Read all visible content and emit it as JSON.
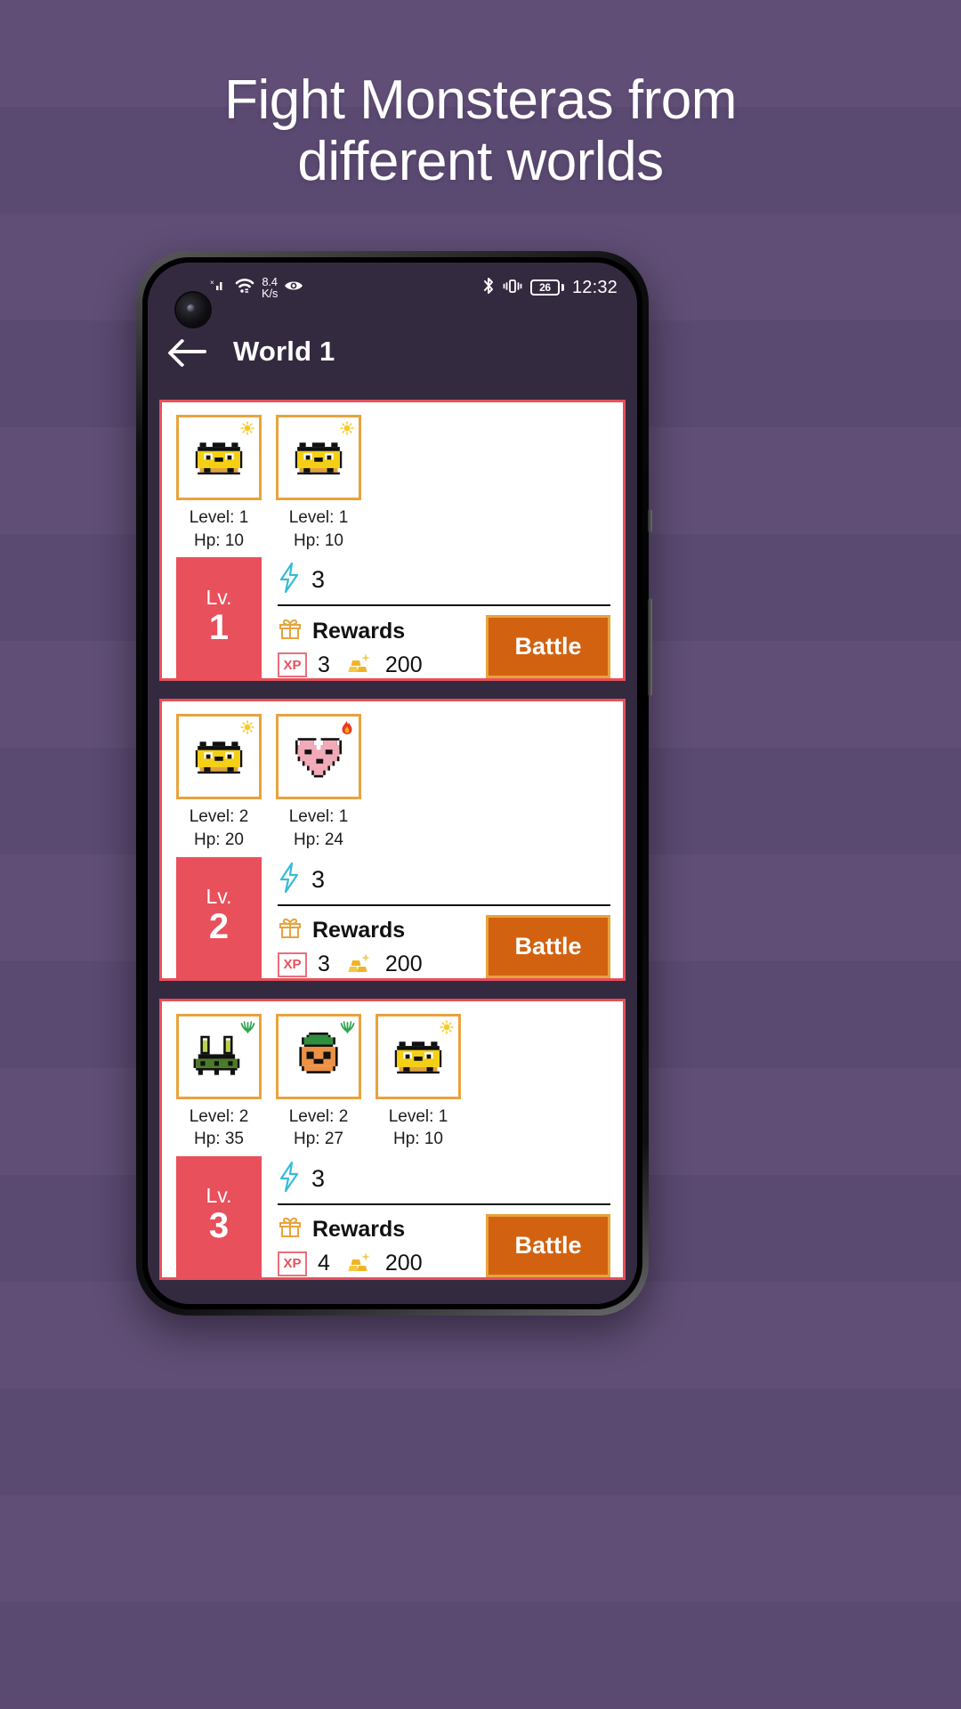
{
  "promo": {
    "headline_line1": "Fight Monsteras from",
    "headline_line2": "different worlds",
    "background_color": "#5d4b74",
    "headline_color": "#ffffff"
  },
  "statusbar": {
    "network_speed_value": "8.4",
    "network_speed_unit": "K/s",
    "signal_icon": "no-sim-signal-icon",
    "wifi_icon": "wifi-icon",
    "eye_icon": "eye-comfort-icon",
    "bluetooth_icon": "bluetooth-icon",
    "vibrate_icon": "vibrate-icon",
    "battery_percent": "26",
    "time": "12:32"
  },
  "appbar": {
    "back_icon": "back-arrow-icon",
    "title": "World 1"
  },
  "theme": {
    "screen_bg": "#342a40",
    "card_bg": "#ffffff",
    "card_border": "#e8505b",
    "level_badge_bg": "#e8505b",
    "sprite_frame": "#e8a33d",
    "battle_btn_bg": "#d2620f",
    "battle_btn_border": "#e8a33d",
    "energy_icon_color": "#35bcd6",
    "gift_icon_color": "#e8a33d",
    "xp_color": "#e8505b"
  },
  "labels": {
    "level_prefix": "Level: ",
    "hp_prefix": "Hp: ",
    "lv_short": "Lv.",
    "rewards": "Rewards",
    "battle": "Battle",
    "xp_chip": "XP",
    "energy_icon": "lightning-bolt-icon",
    "gift_icon": "gift-icon",
    "gold_icon": "gold-bars-icon"
  },
  "stages": [
    {
      "level": "1",
      "energy_cost": "3",
      "rewards_xp": "3",
      "rewards_gold": "200",
      "battle_label": "Battle",
      "monsters": [
        {
          "sprite": "yellow-blob-monster",
          "element": "sun",
          "level": "Level: 1",
          "hp": "Hp: 10"
        },
        {
          "sprite": "yellow-blob-monster",
          "element": "sun",
          "level": "Level: 1",
          "hp": "Hp: 10"
        }
      ]
    },
    {
      "level": "2",
      "energy_cost": "3",
      "rewards_xp": "3",
      "rewards_gold": "200",
      "battle_label": "Battle",
      "monsters": [
        {
          "sprite": "yellow-blob-monster",
          "element": "sun",
          "level": "Level: 2",
          "hp": "Hp: 20"
        },
        {
          "sprite": "pink-heart-monster",
          "element": "fire",
          "level": "Level: 1",
          "hp": "Hp: 24"
        }
      ]
    },
    {
      "level": "3",
      "energy_cost": "3",
      "rewards_xp": "4",
      "rewards_gold": "200",
      "battle_label": "Battle",
      "monsters": [
        {
          "sprite": "green-bug-monster",
          "element": "grass",
          "level": "Level: 2",
          "hp": "Hp: 35"
        },
        {
          "sprite": "orange-carrot-monster",
          "element": "grass",
          "level": "Level: 2",
          "hp": "Hp: 27"
        },
        {
          "sprite": "yellow-blob-monster",
          "element": "sun",
          "level": "Level: 1",
          "hp": "Hp: 10"
        }
      ]
    }
  ]
}
